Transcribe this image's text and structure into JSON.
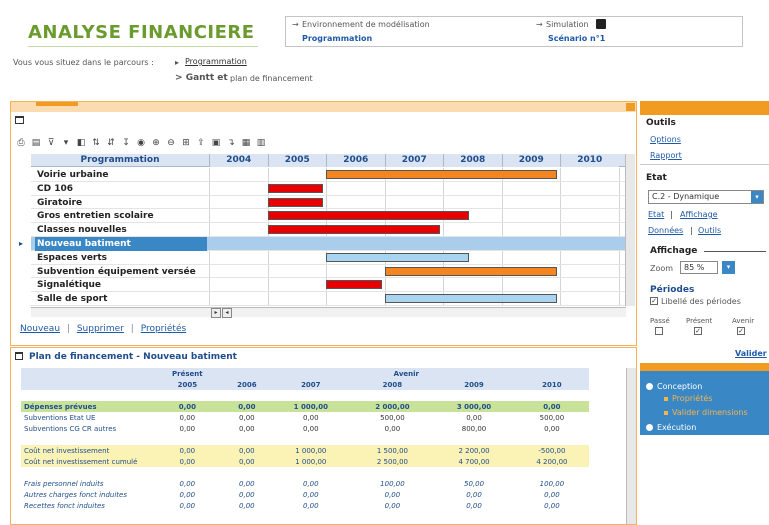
{
  "header": {
    "app_title": "ANALYSE FINANCIERE",
    "env_label": "Environnement de modélisation",
    "env_value": "Programmation",
    "sim_label": "Simulation",
    "sim_value": "Scénario n°1",
    "breadcrumb_prefix": "Vous vous situez dans le parcours :",
    "breadcrumb_link": "Programmation",
    "breadcrumb_item": "Gantt et",
    "breadcrumb_last": "plan de financement"
  },
  "gantt": {
    "column_header": "Programmation",
    "years": [
      "2004",
      "2005",
      "2006",
      "2007",
      "2008",
      "2009",
      "2010"
    ],
    "rows": [
      {
        "name": "Voirie urbaine",
        "color": "orange",
        "start": 2006,
        "end": 2009.95
      },
      {
        "name": "CD 106",
        "color": "red",
        "start": 2005,
        "end": 2005.95
      },
      {
        "name": "Giratoire",
        "color": "red",
        "start": 2005,
        "end": 2005.95
      },
      {
        "name": "Gros entretien scolaire",
        "color": "red",
        "start": 2005,
        "end": 2008.45
      },
      {
        "name": "Classes nouvelles",
        "color": "red",
        "start": 2005,
        "end": 2007.95
      },
      {
        "name": "Nouveau batiment",
        "color": "none",
        "start": null,
        "end": null
      },
      {
        "name": "Espaces verts",
        "color": "blue",
        "start": 2006,
        "end": 2008.45
      },
      {
        "name": "Subvention équipement versée",
        "color": "orange",
        "start": 2007,
        "end": 2009.95
      },
      {
        "name": "Signalétique",
        "color": "red",
        "start": 2006,
        "end": 2006.95
      },
      {
        "name": "Salle de sport",
        "color": "blue",
        "start": 2007,
        "end": 2009.95
      }
    ],
    "selected_row": "Nouveau batiment"
  },
  "links": {
    "new": "Nouveau",
    "delete": "Supprimer",
    "props": "Propriétés"
  },
  "plan": {
    "title": "Plan de financement - Nouveau batiment",
    "present_label": "Présent",
    "avenir_label": "Avenir",
    "years": [
      "2005",
      "2006",
      "2007",
      "2008",
      "2009",
      "2010"
    ],
    "rows": [
      {
        "label": "Dépenses prévues",
        "class": "dep",
        "values": [
          "0,00",
          "0,00",
          "1 000,00",
          "2 000,00",
          "3 000,00",
          "0,00"
        ]
      },
      {
        "label": "Subventions Etat UE",
        "class": "",
        "values": [
          "0,00",
          "0,00",
          "0,00",
          "500,00",
          "0,00",
          "500,00"
        ]
      },
      {
        "label": "Subventions CG CR autres",
        "class": "",
        "values": [
          "0,00",
          "0,00",
          "0,00",
          "0,00",
          "800,00",
          "0,00"
        ]
      },
      {
        "label": "",
        "class": "",
        "values": [
          "",
          "",
          "",
          "",
          "",
          ""
        ]
      },
      {
        "label": "Coût net investissement",
        "class": "cout",
        "values": [
          "0,00",
          "0,00",
          "1 000,00",
          "1 500,00",
          "2 200,00",
          "-500,00"
        ]
      },
      {
        "label": "Coût net investissement cumulé",
        "class": "cout",
        "values": [
          "0,00",
          "0,00",
          "1 000,00",
          "2 500,00",
          "4 700,00",
          "4 200,00"
        ]
      },
      {
        "label": "",
        "class": "",
        "values": [
          "",
          "",
          "",
          "",
          "",
          ""
        ]
      },
      {
        "label": "Frais personnel induits",
        "class": "italic",
        "values": [
          "0,00",
          "0,00",
          "0,00",
          "100,00",
          "50,00",
          "100,00"
        ]
      },
      {
        "label": "Autres charges fonct induites",
        "class": "italic",
        "values": [
          "0,00",
          "0,00",
          "0,00",
          "0,00",
          "0,00",
          "0,00"
        ]
      },
      {
        "label": "Recettes fonct induites",
        "class": "italic",
        "values": [
          "0,00",
          "0,00",
          "0,00",
          "0,00",
          "0,00",
          "0,00"
        ]
      }
    ]
  },
  "side": {
    "outils_title": "Outils",
    "options": "Options",
    "rapport": "Rapport",
    "etat_title": "Etat",
    "etat_select": "C.2 - Dynamique",
    "etat_link": "Etat",
    "affichage_link": "Affichage",
    "donnees_link": "Données",
    "outils_link": "Outils",
    "affichage_title": "Affichage",
    "zoom_label": "Zoom",
    "zoom_value": "85 %",
    "periodes_title": "Périodes",
    "libelle_periodes": "Libellé des périodes",
    "passe": "Passé",
    "present": "Présent",
    "avenir": "Avenir",
    "valider": "Valider",
    "nav_conception": "Conception",
    "nav_proprietes": "Propriétés",
    "nav_valider_dimensions": "Valider dimensions",
    "nav_execution": "Exécution"
  }
}
